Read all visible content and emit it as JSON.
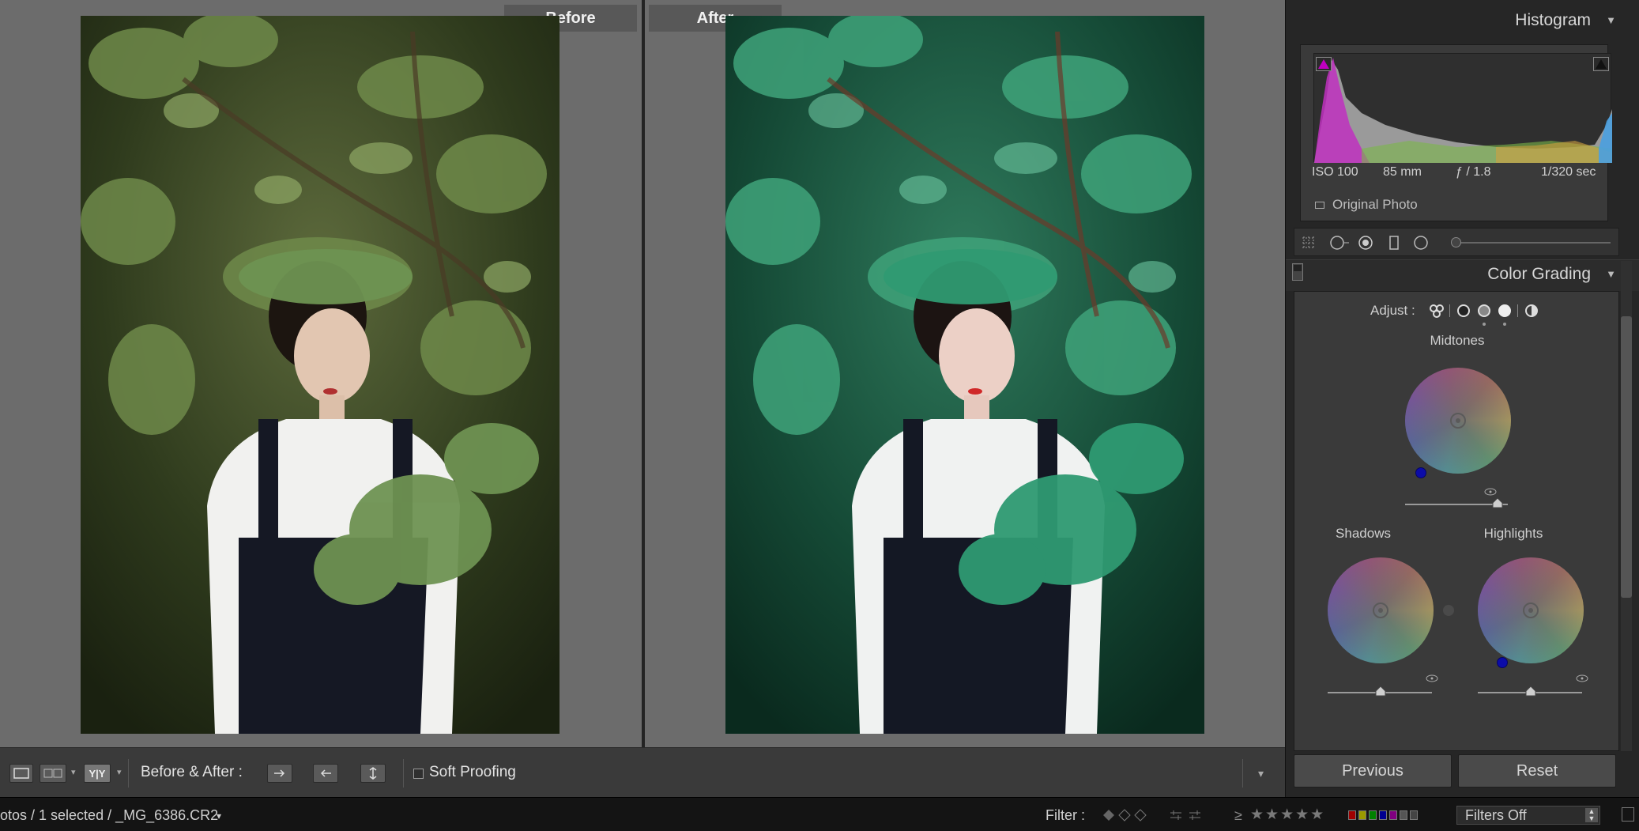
{
  "compare": {
    "before_label": "Before",
    "after_label": "After"
  },
  "toolbar": {
    "before_after_label": "Before & After :",
    "soft_proofing_label": "Soft Proofing",
    "yy_label": "Y|Y"
  },
  "statusbar": {
    "path_text": "otos / 1 selected / _MG_6386.CR2",
    "filter_label": "Filter :",
    "rating_op": "≥",
    "stars": "★★★★★",
    "filters_value": "Filters Off"
  },
  "histogram": {
    "title": "Histogram",
    "iso": "ISO 100",
    "focal": "85 mm",
    "aperture": "ƒ / 1.8",
    "shutter": "1/320 sec",
    "original_photo_label": "Original Photo"
  },
  "color_grading": {
    "title": "Color Grading",
    "adjust_label": "Adjust :",
    "midtones_label": "Midtones",
    "shadows_label": "Shadows",
    "highlights_label": "Highlights"
  },
  "buttons": {
    "previous": "Previous",
    "reset": "Reset"
  },
  "colors": {
    "panel_bg": "#262626",
    "handle_blue": "#0c0ca8",
    "clip_magenta": "#c000c0"
  },
  "icons": [
    "loupe-view-icon",
    "before-after-lr-icon",
    "before-after-yy-icon",
    "swap-settings-icon",
    "copy-settings-icon",
    "swap-view-icon",
    "grid-icon",
    "crop-icon",
    "spot-heal-icon",
    "redeye-icon",
    "gradient-icon",
    "radial-icon",
    "eye-icon"
  ]
}
